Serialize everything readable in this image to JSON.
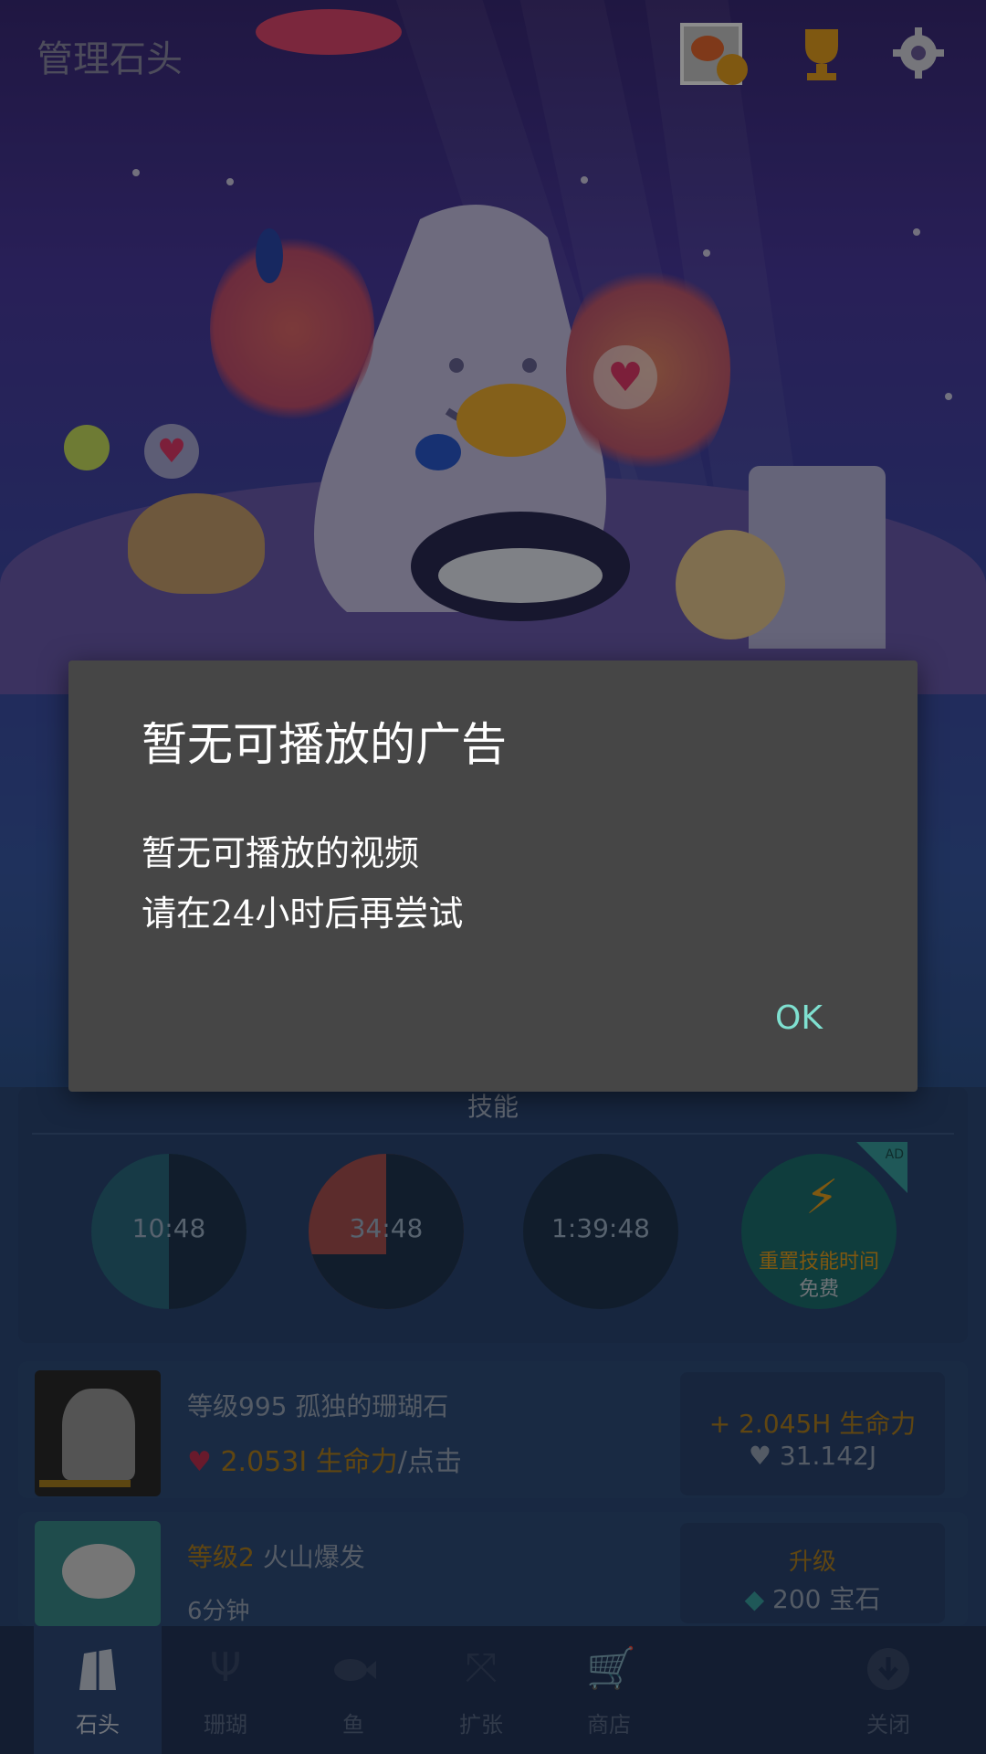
{
  "header": {
    "title": "管理石头",
    "icons": [
      "photo-award-icon",
      "trophy-icon",
      "gear-icon"
    ]
  },
  "skills": {
    "heading": "技能",
    "timers": [
      "10:48",
      "34:48",
      "1:39:48"
    ],
    "reset": {
      "label": "重置技能时间",
      "price": "免费",
      "badge": "AD"
    }
  },
  "rows": [
    {
      "level_prefix": "等级995",
      "name": "孤独的珊瑚石",
      "value": "2.053I 生命力",
      "value_suffix": "/点击",
      "btn_line1": "+ 2.045H 生命力",
      "btn_line2": "31.142J"
    },
    {
      "level_prefix": "等级2",
      "name": "火山爆发",
      "value": "6分钟",
      "btn_line1": "升级",
      "btn_line2": "200 宝石"
    }
  ],
  "tabs": [
    {
      "label": "石头",
      "icon": "stone-icon",
      "active": true
    },
    {
      "label": "珊瑚",
      "icon": "coral-icon"
    },
    {
      "label": "鱼",
      "icon": "fish-icon"
    },
    {
      "label": "扩张",
      "icon": "expand-icon"
    },
    {
      "label": "商店",
      "icon": "cart-icon"
    },
    {
      "label": "关闭",
      "icon": "down-arrow-icon"
    }
  ],
  "dialog": {
    "title": "暂无可播放的广告",
    "message_line1": "暂无可播放的视频",
    "message_line2": "请在24小时后再尝试",
    "ok_label": "OK"
  },
  "colors": {
    "accent_orange": "#e0a030",
    "ok_text": "#7fe0d0",
    "dialog_bg": "#464646"
  }
}
